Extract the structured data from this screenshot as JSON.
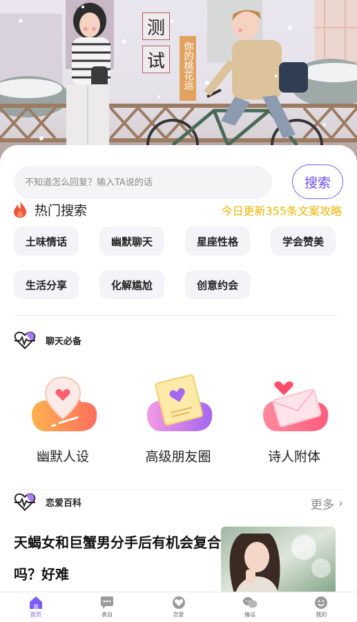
{
  "hero": {
    "title_char_1": "测",
    "title_char_2": "试",
    "subtitle": "你的桃花运"
  },
  "search": {
    "placeholder": "不知道怎么回复？输入TA说的话",
    "button_label": "搜索"
  },
  "hot_search": {
    "icon": "fire-icon",
    "title": "热门搜索",
    "update_text": "今日更新355条文案攻略",
    "update_color": "#f2b400",
    "tags": [
      "土味情话",
      "幽默聊天",
      "星座性格",
      "学会赞美",
      "生活分享",
      "化解尴尬",
      "创意约会"
    ]
  },
  "chat_essentials": {
    "icon": "heartbeat-icon",
    "title": "聊天必备",
    "items": [
      {
        "label": "幽默人设",
        "icon": "location-heart-icon"
      },
      {
        "label": "高级朋友圈",
        "icon": "card-heart-icon"
      },
      {
        "label": "诗人附体",
        "icon": "envelope-heart-icon"
      }
    ]
  },
  "love_wiki": {
    "icon": "heartbeat-icon",
    "title": "恋爱百科",
    "more_label": "更多",
    "article_title": "天蝎女和巨蟹男分手后有机会复合吗？好难"
  },
  "tabbar": {
    "accent": "#7b5cf5",
    "items": [
      {
        "label": "首页",
        "icon": "home-icon",
        "active": true
      },
      {
        "label": "表白",
        "icon": "chat-bubble-icon",
        "active": false
      },
      {
        "label": "恋爱",
        "icon": "heart-badge-icon",
        "active": false
      },
      {
        "label": "情话",
        "icon": "double-bubble-icon",
        "active": false
      },
      {
        "label": "我的",
        "icon": "smiley-icon",
        "active": false
      }
    ]
  }
}
